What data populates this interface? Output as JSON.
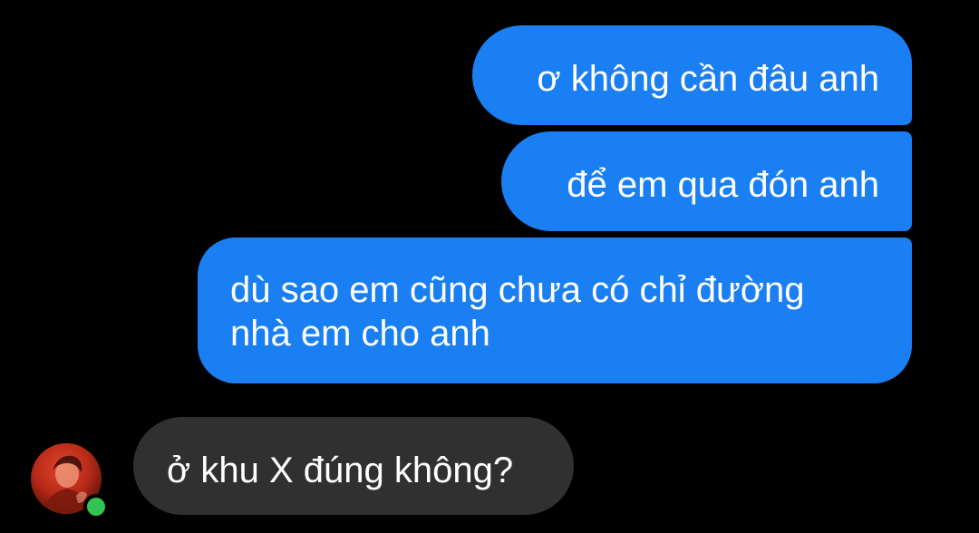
{
  "conversation": {
    "messages": [
      {
        "direction": "sent",
        "text": "ơ không cần đâu anh"
      },
      {
        "direction": "sent",
        "text": "để em qua đón anh"
      },
      {
        "direction": "sent",
        "lines": [
          "dù sao em cũng chưa có chỉ đường",
          "nhà em cho anh"
        ]
      },
      {
        "direction": "received",
        "text": "ở khu X đúng không?"
      }
    ],
    "contact": {
      "avatar_icon": "contact-avatar-photo",
      "status": "online"
    }
  },
  "colors": {
    "background": "#000000",
    "sent_bubble": "#1a7ff2",
    "received_bubble": "#303030",
    "text": "#ffffff",
    "online_dot": "#32c353"
  }
}
